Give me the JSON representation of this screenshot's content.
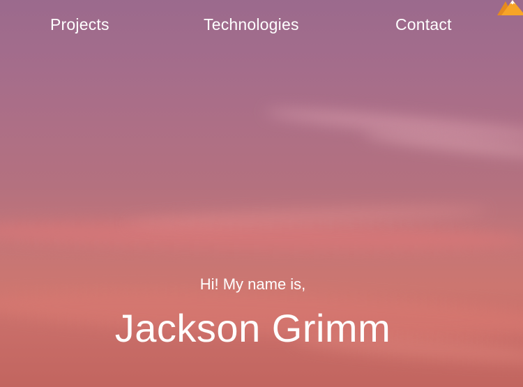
{
  "nav": {
    "items": [
      {
        "label": "Projects"
      },
      {
        "label": "Technologies"
      },
      {
        "label": "Contact"
      }
    ]
  },
  "logo": {
    "icon": "mountain-icon",
    "colors": {
      "front": "#f7a427",
      "back": "#e58a1f",
      "snow": "#ffffff"
    }
  },
  "hero": {
    "greeting": "Hi! My name is,",
    "name": "Jackson Grimm"
  },
  "theme": {
    "background_top": "#9b6a8d",
    "background_bottom": "#c2655f",
    "text": "#ffffff"
  }
}
